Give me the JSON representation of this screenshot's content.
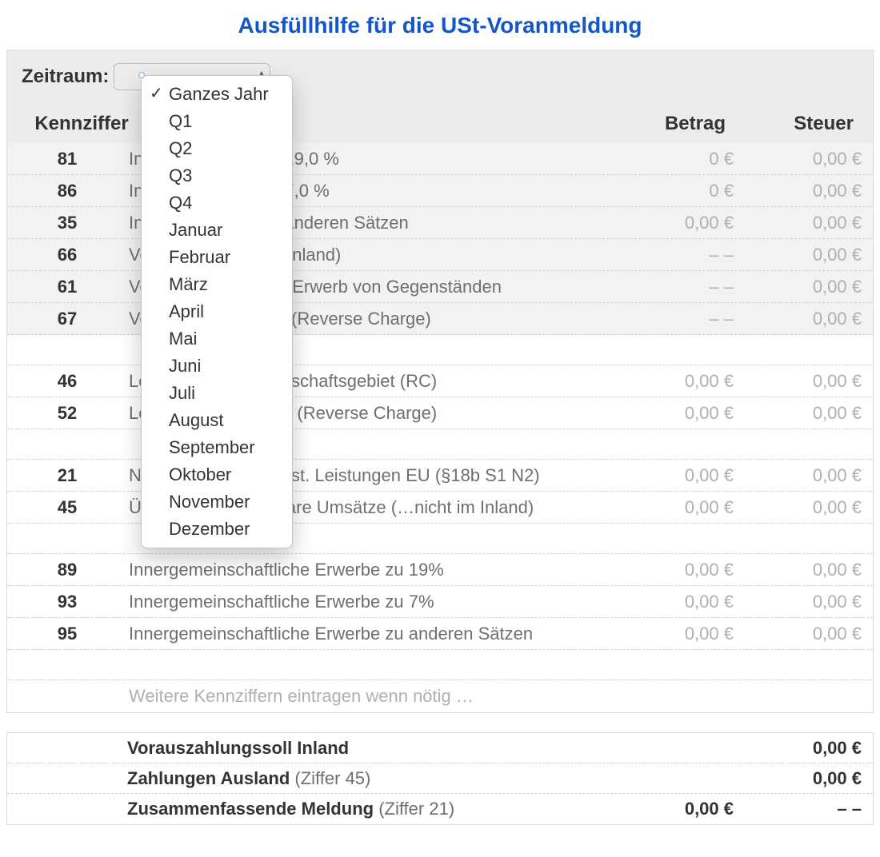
{
  "title": "Ausfüllhilfe für die USt-Voranmeldung",
  "period": {
    "label": "Zeitraum:",
    "selected": "Ganzes Jahr",
    "options": [
      "Ganzes Jahr",
      "Q1",
      "Q2",
      "Q3",
      "Q4",
      "Januar",
      "Februar",
      "März",
      "April",
      "Mai",
      "Juni",
      "Juli",
      "August",
      "September",
      "Oktober",
      "November",
      "Dezember"
    ]
  },
  "columns": {
    "kennziffer": "Kennziffer",
    "betrag": "Betrag",
    "steuer": "Steuer"
  },
  "rows": [
    {
      "kenn": "81",
      "desc": "Inland: Umsätze zu 19,0 %",
      "betrag": "0 €",
      "steuer": "0,00 €",
      "shaded": true
    },
    {
      "kenn": "86",
      "desc": "Inland: Umsätze zu 7,0 %",
      "betrag": "0 €",
      "steuer": "0,00 €",
      "shaded": true
    },
    {
      "kenn": "35",
      "desc": "Inland: Umsätze zu anderen Sätzen",
      "betrag": "0,00 €",
      "steuer": "0,00 €",
      "shaded": true
    },
    {
      "kenn": "66",
      "desc": "Vorsteuer (aus dem Inland)",
      "betrag": "– –",
      "steuer": "0,00 €",
      "shaded": true
    },
    {
      "kenn": "61",
      "desc": "Vorsteuer innergem. Erwerb von Gegenständen",
      "betrag": "– –",
      "steuer": "0,00 €",
      "shaded": true
    },
    {
      "kenn": "67",
      "desc": "Vorsteuer 13b UStG (Reverse Charge)",
      "betrag": "– –",
      "steuer": "0,00 €",
      "shaded": true
    },
    {
      "spacer": true
    },
    {
      "kenn": "46",
      "desc": "Leistungen / Gemeinschaftsgebiet (RC)",
      "betrag": "0,00 €",
      "steuer": "0,00 €"
    },
    {
      "kenn": "52",
      "desc": "Leistungen / Ausland (Reverse Charge)",
      "betrag": "0,00 €",
      "steuer": "0,00 €"
    },
    {
      "spacer": true
    },
    {
      "kenn": "21",
      "desc": "Nicht steuerbare sonst. Leistungen EU (§18b S1 N2)",
      "betrag": "0,00 €",
      "steuer": "0,00 €"
    },
    {
      "kenn": "45",
      "desc": "Übrige nicht steuerbare Umsätze (…nicht im Inland)",
      "betrag": "0,00 €",
      "steuer": "0,00 €"
    },
    {
      "spacer": true
    },
    {
      "kenn": "89",
      "desc": "Innergemeinschaftliche Erwerbe zu 19%",
      "betrag": "0,00 €",
      "steuer": "0,00 €"
    },
    {
      "kenn": "93",
      "desc": "Innergemeinschaftliche Erwerbe zu 7%",
      "betrag": "0,00 €",
      "steuer": "0,00 €"
    },
    {
      "kenn": "95",
      "desc": "Innergemeinschaftliche Erwerbe zu anderen Sätzen",
      "betrag": "0,00 €",
      "steuer": "0,00 €"
    },
    {
      "spacer": true
    }
  ],
  "footer_note": "Weitere Kennziffern eintragen wenn nötig …",
  "summary": [
    {
      "label": "Vorauszahlungssoll Inland",
      "sub": "",
      "v1": "",
      "v2": "0,00 €"
    },
    {
      "label": "Zahlungen Ausland",
      "sub": " (Ziffer 45)",
      "v1": "",
      "v2": "0,00 €"
    },
    {
      "label": "Zusammenfassende Meldung",
      "sub": " (Ziffer 21)",
      "v1": "0,00 €",
      "v2": "– –"
    }
  ]
}
